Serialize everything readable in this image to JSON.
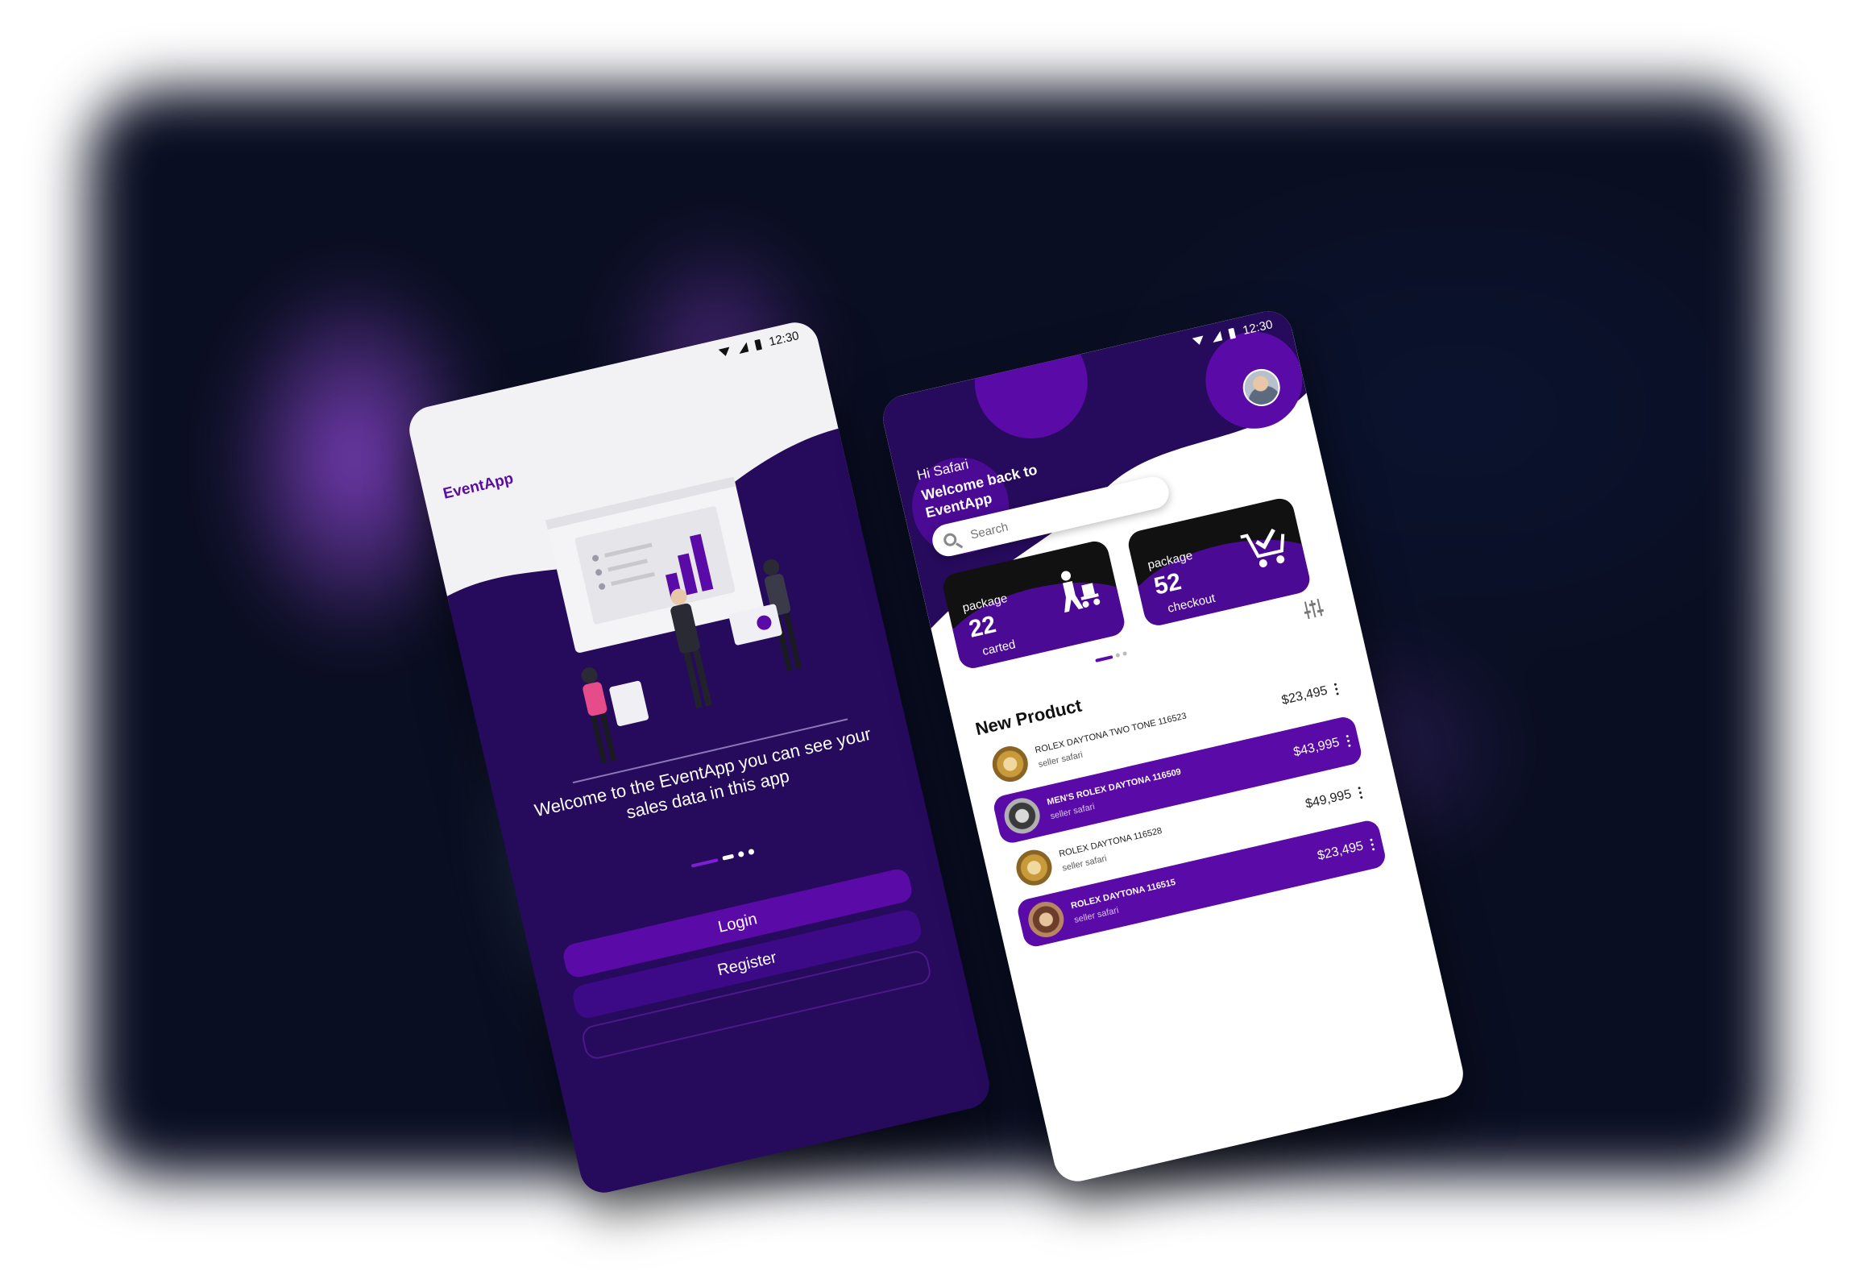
{
  "phone_a": {
    "status_time": "12:30",
    "brand": "EventApp",
    "welcome_text": "Welcome to the EventApp you can see your sales data in this app",
    "login_label": "Login",
    "register_label": "Register"
  },
  "phone_b": {
    "status_time": "12:30",
    "greeting": "Hi Safari",
    "welcome": "Welcome back to EventApp",
    "search_placeholder": "Search",
    "cards": [
      {
        "label": "package",
        "value": "22",
        "caption": "carted",
        "icon": "delivery-person-icon"
      },
      {
        "label": "package",
        "value": "52",
        "caption": "checkout",
        "icon": "cart-check-icon"
      }
    ],
    "section_title": "New Product",
    "products": [
      {
        "name": "ROLEX DAYTONA TWO TONE 116523",
        "seller": "seller safari",
        "price": "$23,495"
      },
      {
        "name": "MEN'S ROLEX DAYTONA 116509",
        "seller": "seller safari",
        "price": "$43,995"
      },
      {
        "name": "ROLEX DAYTONA 116528",
        "seller": "seller safari",
        "price": "$49,995"
      },
      {
        "name": "ROLEX DAYTONA 116515",
        "seller": "seller safari",
        "price": "$23,495"
      }
    ]
  },
  "colors": {
    "primary": "#5a0aa6",
    "deep_purple": "#260a5c",
    "backdrop": "#0a0e22"
  }
}
